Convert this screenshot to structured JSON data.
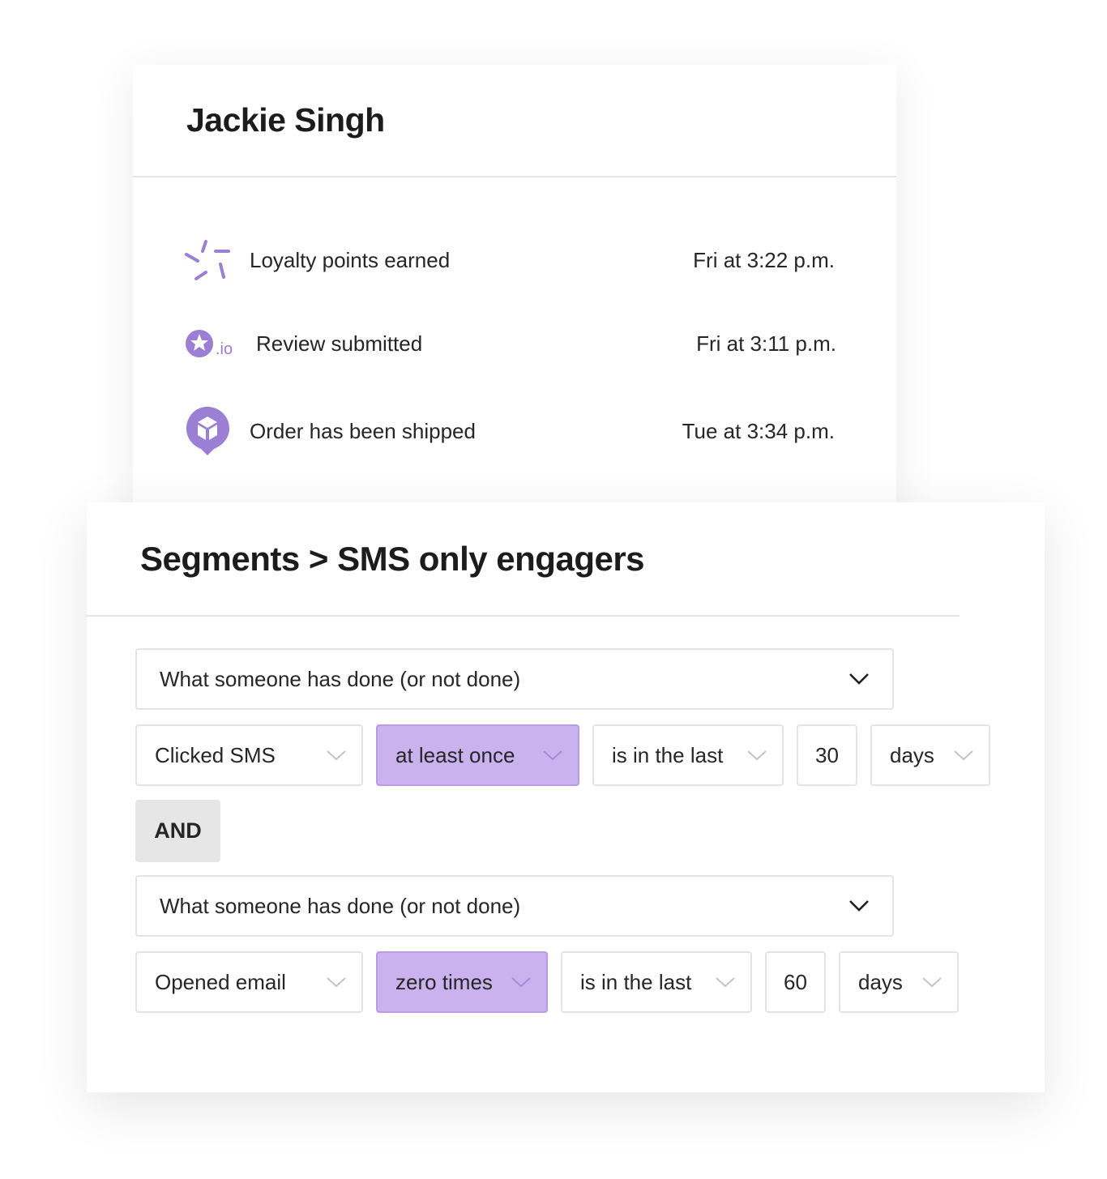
{
  "profile": {
    "name": "Jackie Singh",
    "activities": [
      {
        "label": "Loyalty points earned",
        "time": "Fri at 3:22 p.m.",
        "icon": "loyalty-burst-icon"
      },
      {
        "label": "Review submitted",
        "time": "Fri at 3:11 p.m.",
        "icon": "star-review-icon",
        "icon_suffix": ".io"
      },
      {
        "label": "Order has been shipped",
        "time": "Tue at 3:34 p.m.",
        "icon": "package-pin-icon"
      }
    ]
  },
  "segment": {
    "title": "Segments > SMS only engagers",
    "conditions": [
      {
        "type": "What someone has done (or not done)",
        "action": "Clicked SMS",
        "frequency": "at least once",
        "timeframe": "is in the last",
        "amount": "30",
        "unit": "days"
      },
      {
        "type": "What someone has done (or not done)",
        "action": "Opened email",
        "frequency": "zero times",
        "timeframe": "is in the last",
        "amount": "60",
        "unit": "days"
      }
    ],
    "joiner": "AND"
  },
  "colors": {
    "accent": "#9b7fd4",
    "highlight": "#c9b2ee",
    "border": "#e4e4e4",
    "badge_bg": "#e6e6e6"
  }
}
